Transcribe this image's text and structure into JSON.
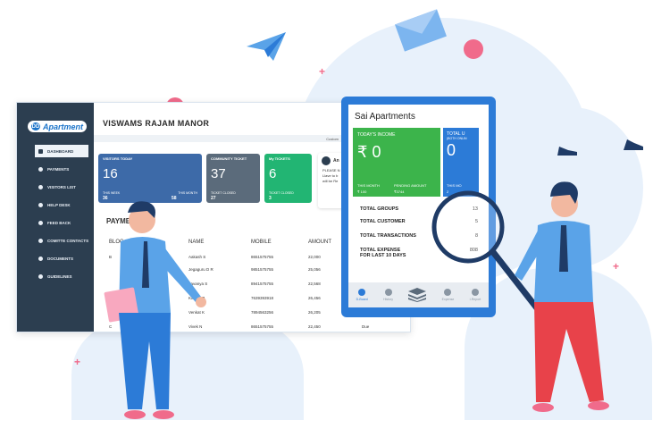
{
  "desktop": {
    "logo": "Apartment",
    "logo_badge": "DD",
    "title": "VISWAMS RAJAM MANOR",
    "custom_label": "Custom",
    "nav": [
      {
        "label": "DASHBOARD"
      },
      {
        "label": "PAYMENTS"
      },
      {
        "label": "VISITORS LIST"
      },
      {
        "label": "HELP DESK"
      },
      {
        "label": "FEED BACK"
      },
      {
        "label": "COMITTE CONTACTS"
      },
      {
        "label": "DOCUMENTS"
      },
      {
        "label": "GUIDELINES"
      }
    ],
    "cards": [
      {
        "title": "VISITORS TODAY",
        "value": "16",
        "sub1": "THIS WEEK",
        "val1": "36",
        "sub2": "THIS MONTH",
        "val2": "58",
        "color": "#3d6aa8"
      },
      {
        "title": "COMMUNITY TICKET",
        "value": "37",
        "sub1": "TICKET CLOSED",
        "val1": "27",
        "color": "#5b6b7b"
      },
      {
        "title": "My TICKETS",
        "value": "6",
        "sub1": "TICKET CLOSED",
        "val1": "3",
        "color": "#22b573"
      }
    ],
    "announce_title": "An",
    "announce_lines": [
      "PLEASE N",
      "Llave to b",
      "will be Re"
    ],
    "payments_title": "PAYME",
    "table_headers": [
      "BLOC",
      "NAME",
      "MOBILE",
      "AMOUNT"
    ],
    "rows": [
      {
        "block": "B",
        "name": "Aakash S",
        "mobile": "8651575755",
        "amount": "22,000"
      },
      {
        "block": "",
        "name": "Jegaguru D R",
        "mobile": "9851575755",
        "amount": "25,056"
      },
      {
        "block": "",
        "name": "Lavanya S",
        "mobile": "8941575755",
        "amount": "22,568"
      },
      {
        "block": "",
        "name": "Karthik P",
        "mobile": "7639393918",
        "amount": "26,456"
      },
      {
        "block": "",
        "name": "Venkat K",
        "mobile": "7894563256",
        "amount": "26,205"
      },
      {
        "block": "C",
        "name": "Vivek N",
        "mobile": "8651575755",
        "amount": "22,450",
        "status": "Due"
      }
    ]
  },
  "tablet": {
    "title": "Sai Apartments",
    "income_label": "TODAY'S INCOME",
    "income_value": "₹ 0",
    "this_month_label": "THIS MONTH",
    "this_month_value": "₹ 100",
    "pending_label": "PENDING AMOUNT",
    "pending_value": "₹3744",
    "users_label": "TOTAL U",
    "users_sub": "(BOTH ONLIN",
    "users_value": "0",
    "users_this_month": "THIS MO",
    "users_month_value": "2",
    "stats": [
      {
        "label": "TOTAL GROUPS",
        "value": "13"
      },
      {
        "label": "TOTAL CUSTOMER",
        "value": "5"
      },
      {
        "label": "TOTAL TRANSACTIONS",
        "value": "8"
      },
      {
        "label": "TOTAL EXPENSE",
        "label2": "FOR LAST 10 DAYS",
        "value": "808"
      }
    ],
    "bottom_nav": [
      "D-Board",
      "History",
      "",
      "Expense",
      "I-Report"
    ]
  }
}
